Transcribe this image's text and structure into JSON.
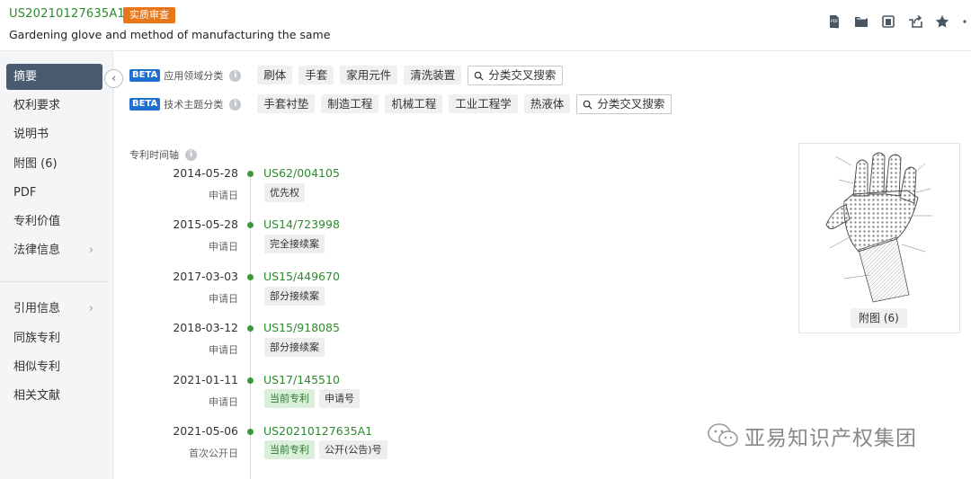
{
  "header": {
    "pub_number": "US20210127635A1",
    "status_badge": "实质审查",
    "title": "Gardening glove and method of manufacturing the same",
    "toolbar_icons": [
      "pdf-download-icon",
      "folder-icon",
      "copy-icon",
      "share-icon",
      "star-icon",
      "more-icon"
    ]
  },
  "sidebar": {
    "items": [
      {
        "label": "摘要",
        "active": true
      },
      {
        "label": "权利要求"
      },
      {
        "label": "说明书"
      },
      {
        "label": "附图 (6)"
      },
      {
        "label": "PDF"
      },
      {
        "label": "专利价值"
      },
      {
        "label": "法律信息",
        "has_submenu": true
      },
      {
        "label": "引用信息",
        "has_submenu": true
      },
      {
        "label": "同族专利"
      },
      {
        "label": "相似专利"
      },
      {
        "label": "相关文献"
      }
    ],
    "collapse_glyph": "‹"
  },
  "classification": {
    "beta": "BETA",
    "application": {
      "label": "应用领域分类",
      "tags": [
        "刷体",
        "手套",
        "家用元件",
        "清洗装置"
      ],
      "cross_search": "分类交叉搜索"
    },
    "technical": {
      "label": "技术主题分类",
      "tags": [
        "手套衬垫",
        "制造工程",
        "机械工程",
        "工业工程学",
        "热液体"
      ],
      "cross_search": "分类交叉搜索"
    }
  },
  "timeline": {
    "heading": "专利时间轴",
    "entries": [
      {
        "date": "2014-05-28",
        "type": "申请日",
        "number": "US62/004105",
        "tags": [
          "优先权"
        ]
      },
      {
        "date": "2015-05-28",
        "type": "申请日",
        "number": "US14/723998",
        "tags": [
          "完全接续案"
        ]
      },
      {
        "date": "2017-03-03",
        "type": "申请日",
        "number": "US15/449670",
        "tags": [
          "部分接续案"
        ]
      },
      {
        "date": "2018-03-12",
        "type": "申请日",
        "number": "US15/918085",
        "tags": [
          "部分接续案"
        ]
      },
      {
        "date": "2021-01-11",
        "type": "申请日",
        "number": "US17/145510",
        "tags": [
          "当前专利",
          "申请号"
        ]
      },
      {
        "date": "2021-05-06",
        "type": "首次公开日",
        "number": "US20210127635A1",
        "tags": [
          "当前专利",
          "公开(公告)号"
        ]
      }
    ]
  },
  "figure": {
    "button_label": "附图 (6)"
  },
  "watermark": {
    "text": "亚易知识产权集团"
  },
  "colors": {
    "accent_green": "#2c8a2c",
    "badge_orange": "#e8761b",
    "beta_blue": "#1f6fd1",
    "sidebar_active": "#4a5b70"
  }
}
